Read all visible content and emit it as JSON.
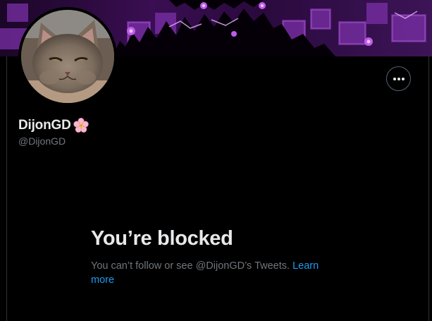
{
  "profile": {
    "display_name": "DijonGD",
    "name_emoji_icon": "cherry-blossom-icon",
    "handle": "@DijonGD",
    "avatar_icon": "cat-avatar-icon",
    "banner_colors": {
      "dark": "#0d0214",
      "purple": "#9b3fd6",
      "magenta": "#c05bea"
    }
  },
  "actions": {
    "more_icon": "more-horizontal-icon"
  },
  "blocked": {
    "title": "You’re blocked",
    "message": "You can’t follow or see @DijonGD’s Tweets.",
    "learn_more": "Learn more"
  },
  "colors": {
    "background": "#000000",
    "primary_text": "#e7e9ea",
    "secondary_text": "#71767b",
    "link": "#1d9bf0",
    "border": "#2f3336"
  }
}
